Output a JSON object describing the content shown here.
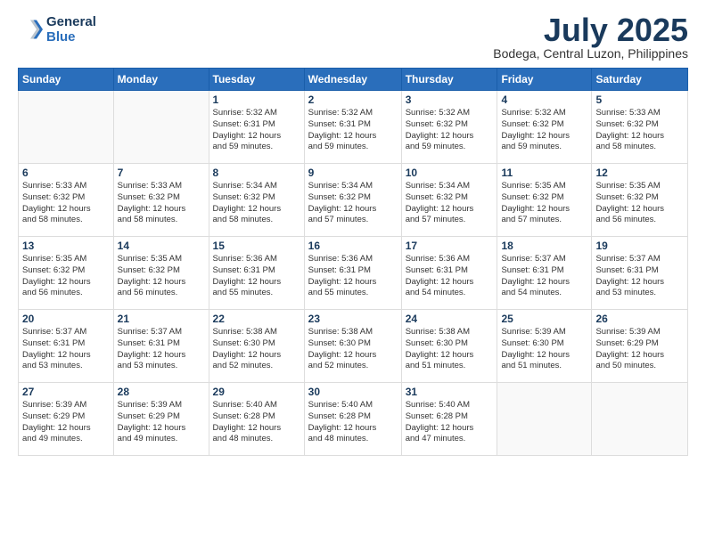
{
  "logo": {
    "line1": "General",
    "line2": "Blue"
  },
  "title": "July 2025",
  "location": "Bodega, Central Luzon, Philippines",
  "days_header": [
    "Sunday",
    "Monday",
    "Tuesday",
    "Wednesday",
    "Thursday",
    "Friday",
    "Saturday"
  ],
  "weeks": [
    [
      {
        "day": "",
        "info": ""
      },
      {
        "day": "",
        "info": ""
      },
      {
        "day": "1",
        "info": "Sunrise: 5:32 AM\nSunset: 6:31 PM\nDaylight: 12 hours\nand 59 minutes."
      },
      {
        "day": "2",
        "info": "Sunrise: 5:32 AM\nSunset: 6:31 PM\nDaylight: 12 hours\nand 59 minutes."
      },
      {
        "day": "3",
        "info": "Sunrise: 5:32 AM\nSunset: 6:32 PM\nDaylight: 12 hours\nand 59 minutes."
      },
      {
        "day": "4",
        "info": "Sunrise: 5:32 AM\nSunset: 6:32 PM\nDaylight: 12 hours\nand 59 minutes."
      },
      {
        "day": "5",
        "info": "Sunrise: 5:33 AM\nSunset: 6:32 PM\nDaylight: 12 hours\nand 58 minutes."
      }
    ],
    [
      {
        "day": "6",
        "info": "Sunrise: 5:33 AM\nSunset: 6:32 PM\nDaylight: 12 hours\nand 58 minutes."
      },
      {
        "day": "7",
        "info": "Sunrise: 5:33 AM\nSunset: 6:32 PM\nDaylight: 12 hours\nand 58 minutes."
      },
      {
        "day": "8",
        "info": "Sunrise: 5:34 AM\nSunset: 6:32 PM\nDaylight: 12 hours\nand 58 minutes."
      },
      {
        "day": "9",
        "info": "Sunrise: 5:34 AM\nSunset: 6:32 PM\nDaylight: 12 hours\nand 57 minutes."
      },
      {
        "day": "10",
        "info": "Sunrise: 5:34 AM\nSunset: 6:32 PM\nDaylight: 12 hours\nand 57 minutes."
      },
      {
        "day": "11",
        "info": "Sunrise: 5:35 AM\nSunset: 6:32 PM\nDaylight: 12 hours\nand 57 minutes."
      },
      {
        "day": "12",
        "info": "Sunrise: 5:35 AM\nSunset: 6:32 PM\nDaylight: 12 hours\nand 56 minutes."
      }
    ],
    [
      {
        "day": "13",
        "info": "Sunrise: 5:35 AM\nSunset: 6:32 PM\nDaylight: 12 hours\nand 56 minutes."
      },
      {
        "day": "14",
        "info": "Sunrise: 5:35 AM\nSunset: 6:32 PM\nDaylight: 12 hours\nand 56 minutes."
      },
      {
        "day": "15",
        "info": "Sunrise: 5:36 AM\nSunset: 6:31 PM\nDaylight: 12 hours\nand 55 minutes."
      },
      {
        "day": "16",
        "info": "Sunrise: 5:36 AM\nSunset: 6:31 PM\nDaylight: 12 hours\nand 55 minutes."
      },
      {
        "day": "17",
        "info": "Sunrise: 5:36 AM\nSunset: 6:31 PM\nDaylight: 12 hours\nand 54 minutes."
      },
      {
        "day": "18",
        "info": "Sunrise: 5:37 AM\nSunset: 6:31 PM\nDaylight: 12 hours\nand 54 minutes."
      },
      {
        "day": "19",
        "info": "Sunrise: 5:37 AM\nSunset: 6:31 PM\nDaylight: 12 hours\nand 53 minutes."
      }
    ],
    [
      {
        "day": "20",
        "info": "Sunrise: 5:37 AM\nSunset: 6:31 PM\nDaylight: 12 hours\nand 53 minutes."
      },
      {
        "day": "21",
        "info": "Sunrise: 5:37 AM\nSunset: 6:31 PM\nDaylight: 12 hours\nand 53 minutes."
      },
      {
        "day": "22",
        "info": "Sunrise: 5:38 AM\nSunset: 6:30 PM\nDaylight: 12 hours\nand 52 minutes."
      },
      {
        "day": "23",
        "info": "Sunrise: 5:38 AM\nSunset: 6:30 PM\nDaylight: 12 hours\nand 52 minutes."
      },
      {
        "day": "24",
        "info": "Sunrise: 5:38 AM\nSunset: 6:30 PM\nDaylight: 12 hours\nand 51 minutes."
      },
      {
        "day": "25",
        "info": "Sunrise: 5:39 AM\nSunset: 6:30 PM\nDaylight: 12 hours\nand 51 minutes."
      },
      {
        "day": "26",
        "info": "Sunrise: 5:39 AM\nSunset: 6:29 PM\nDaylight: 12 hours\nand 50 minutes."
      }
    ],
    [
      {
        "day": "27",
        "info": "Sunrise: 5:39 AM\nSunset: 6:29 PM\nDaylight: 12 hours\nand 49 minutes."
      },
      {
        "day": "28",
        "info": "Sunrise: 5:39 AM\nSunset: 6:29 PM\nDaylight: 12 hours\nand 49 minutes."
      },
      {
        "day": "29",
        "info": "Sunrise: 5:40 AM\nSunset: 6:28 PM\nDaylight: 12 hours\nand 48 minutes."
      },
      {
        "day": "30",
        "info": "Sunrise: 5:40 AM\nSunset: 6:28 PM\nDaylight: 12 hours\nand 48 minutes."
      },
      {
        "day": "31",
        "info": "Sunrise: 5:40 AM\nSunset: 6:28 PM\nDaylight: 12 hours\nand 47 minutes."
      },
      {
        "day": "",
        "info": ""
      },
      {
        "day": "",
        "info": ""
      }
    ]
  ]
}
